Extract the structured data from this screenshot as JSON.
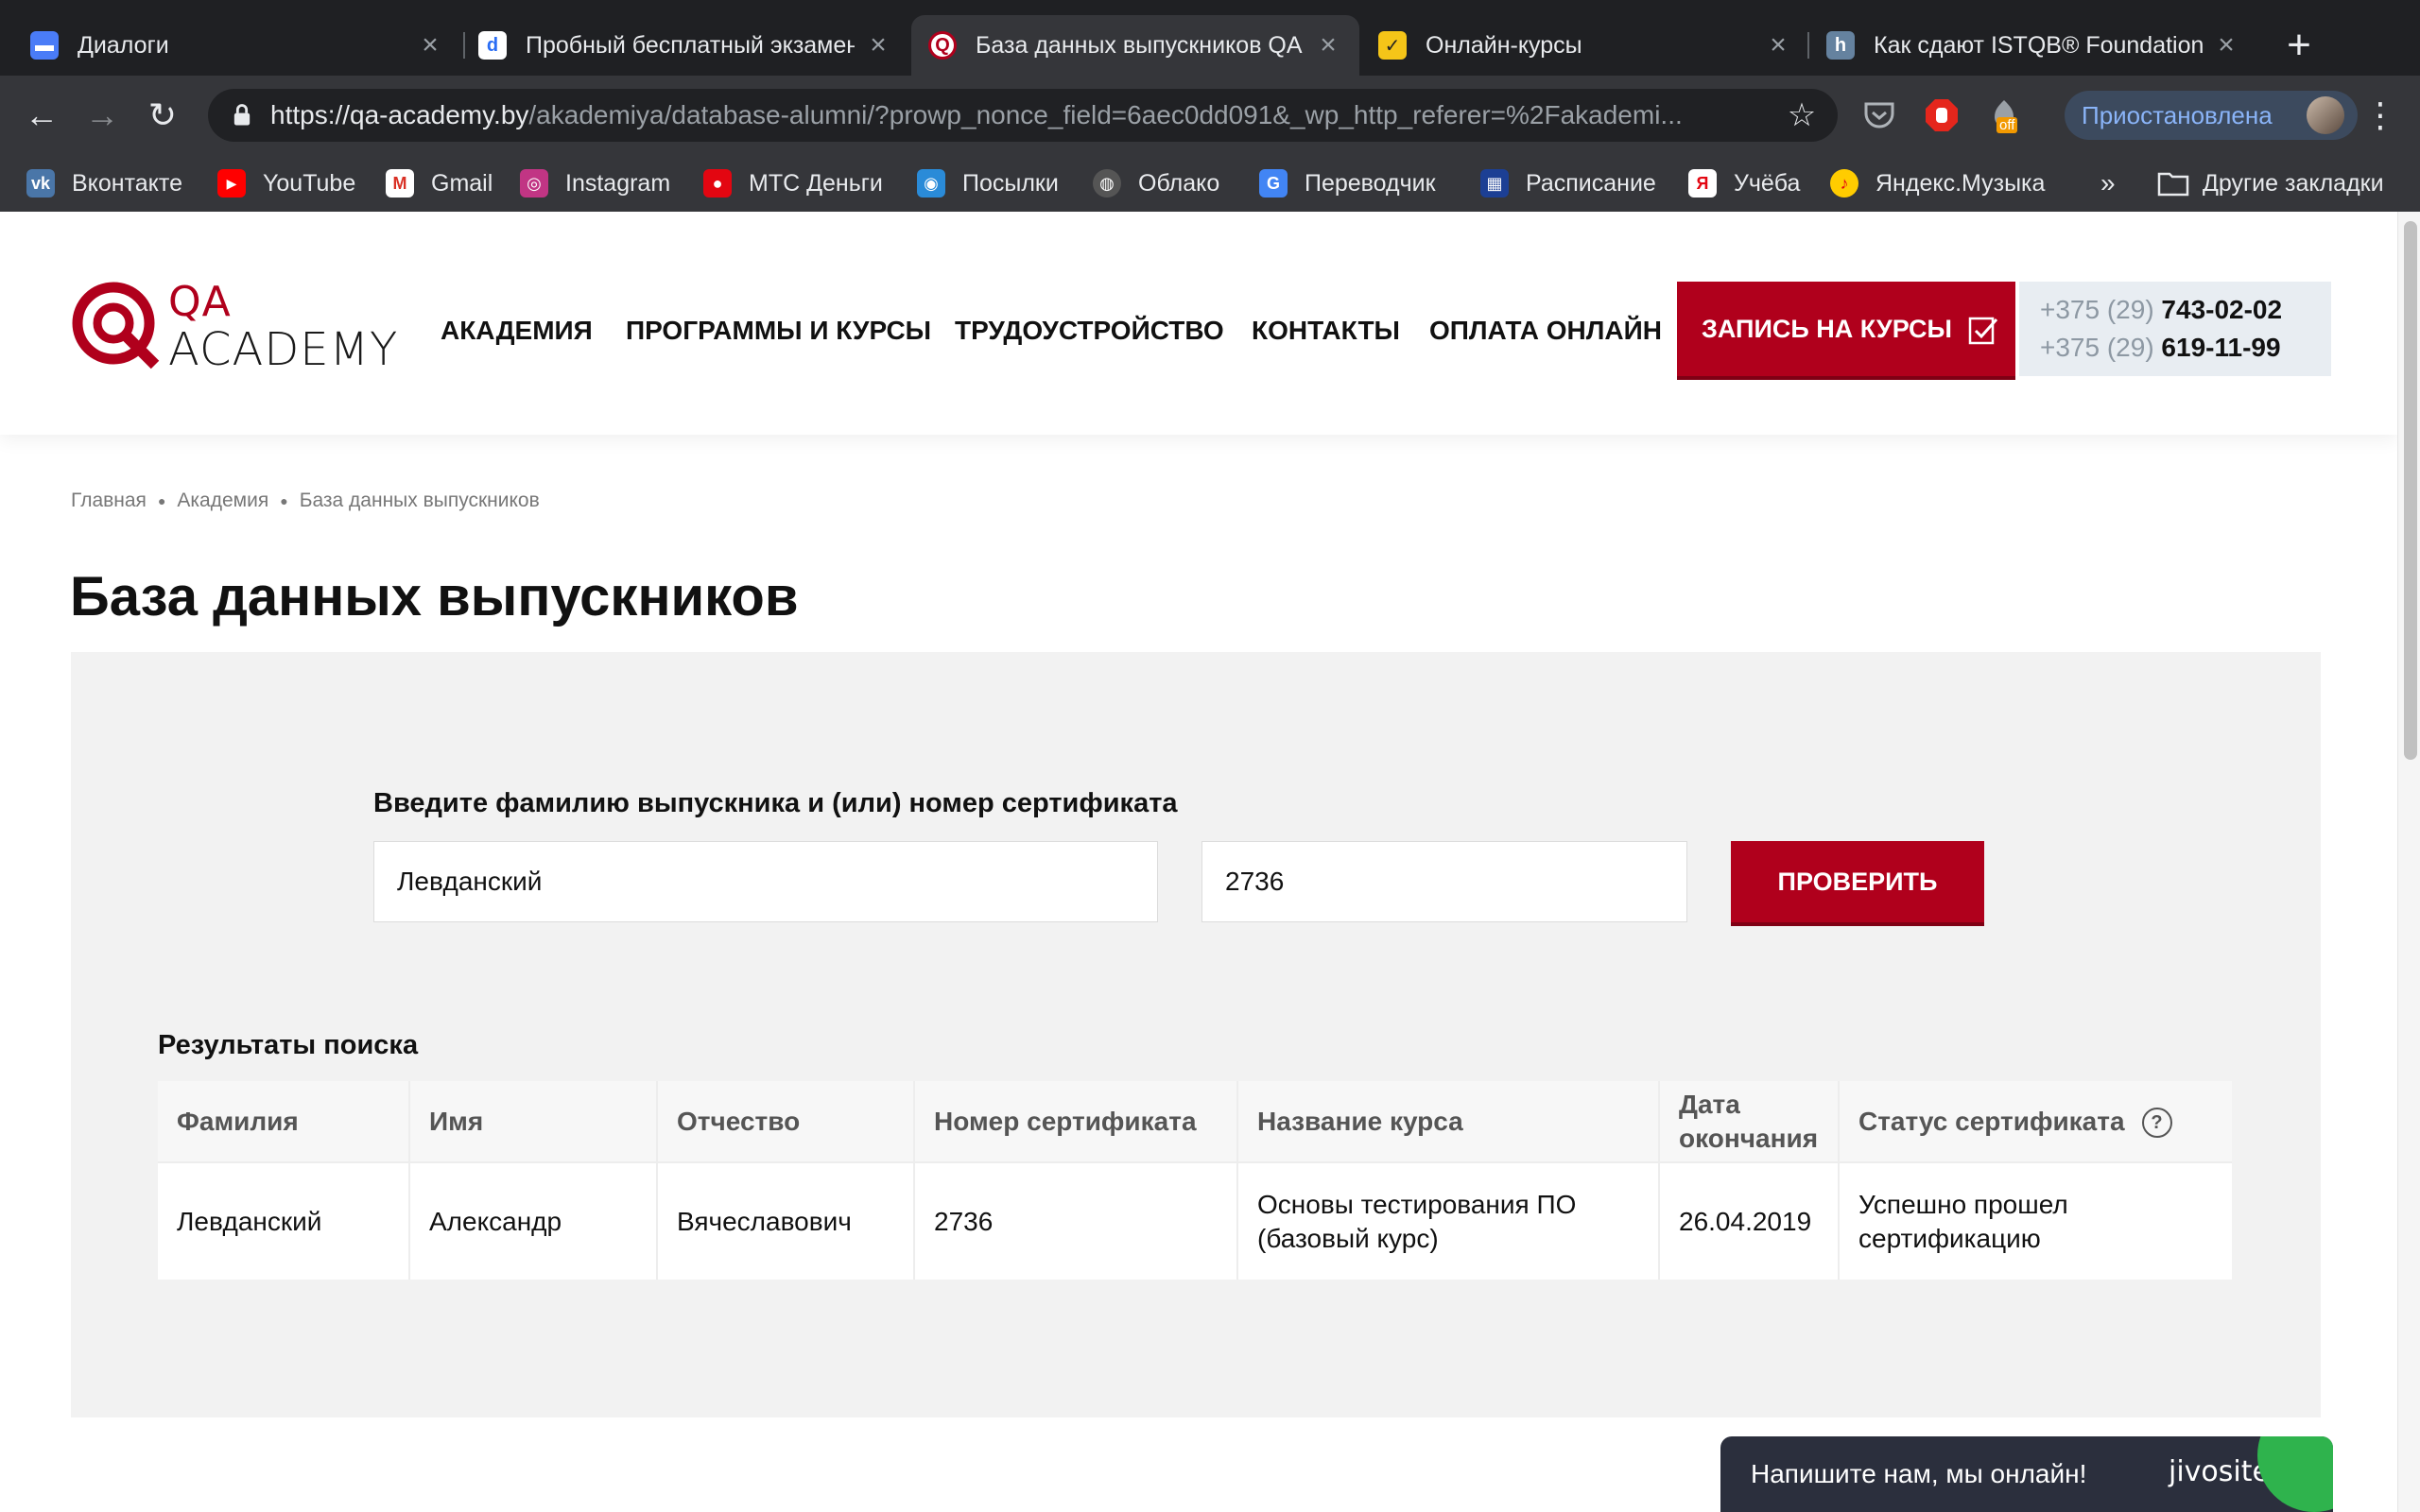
{
  "browser": {
    "tabs": [
      {
        "title": "Диалоги",
        "icon": "chat-bubble-icon",
        "color": "#4a7cf7",
        "active": false
      },
      {
        "title": "Пробный бесплатный экзамен",
        "icon": "d-letter-icon",
        "color": "#2a6df4",
        "active": false
      },
      {
        "title": "База данных выпускников QA",
        "icon": "qa-logo-icon",
        "color": "#b0001c",
        "active": true
      },
      {
        "title": "Онлайн-курсы",
        "icon": "checkbox-yellow-icon",
        "color": "#f5c518",
        "active": false
      },
      {
        "title": "Как сдают ISTQB® Foundation",
        "icon": "h-letter-icon",
        "color": "#65829f",
        "active": false
      }
    ],
    "url_main": "https://qa-academy.by",
    "url_rest": "/akademiya/database-alumni/?prowp_nonce_field=6aec0dd091&_wp_http_referer=%2Fakademi...",
    "profile_status": "Приостановлена",
    "ext_badge": "off",
    "bookmarks": [
      {
        "label": "Вконтакте",
        "icon": "vk-icon",
        "color": "#4a76a8"
      },
      {
        "label": "YouTube",
        "icon": "youtube-icon",
        "color": "#ff0000"
      },
      {
        "label": "Gmail",
        "icon": "gmail-icon",
        "color": "#d93025"
      },
      {
        "label": "Instagram",
        "icon": "instagram-icon",
        "color": "#c13584"
      },
      {
        "label": "МТС Деньги",
        "icon": "mts-icon",
        "color": "#e30611"
      },
      {
        "label": "Посылки",
        "icon": "parcel-icon",
        "color": "#2a8bd8"
      },
      {
        "label": "Облако",
        "icon": "globe-icon",
        "color": "#555555"
      },
      {
        "label": "Переводчик",
        "icon": "translate-icon",
        "color": "#4285f4"
      },
      {
        "label": "Расписание",
        "icon": "schedule-icon",
        "color": "#1c3f94"
      },
      {
        "label": "Учёба",
        "icon": "yandex-icon",
        "color": "#ffffff"
      },
      {
        "label": "Яндекс.Музыка",
        "icon": "music-icon",
        "color": "#ffcc00"
      }
    ],
    "more_bookmarks": "»",
    "other_bookmarks": "Другие закладки"
  },
  "site": {
    "logo_qa": "QA",
    "logo_academy": "ACADEMY",
    "nav": [
      "АКАДЕМИЯ",
      "ПРОГРАММЫ И КУРСЫ",
      "ТРУДОУСТРОЙСТВО",
      "КОНТАКТЫ",
      "ОПЛАТА ОНЛАЙН"
    ],
    "cta": "ЗАПИСЬ НА КУРСЫ",
    "phones": [
      {
        "code": "+375 (29)",
        "number": "743-02-02"
      },
      {
        "code": "+375 (29)",
        "number": "619-11-99"
      }
    ],
    "accent": "#b0001c"
  },
  "breadcrumb": [
    "Главная",
    "Академия",
    "База данных выпускников"
  ],
  "page_title": "База данных выпускников",
  "search": {
    "label": "Введите фамилию выпускника и (или) номер сертификата",
    "surname_value": "Левданский",
    "cert_value": "2736",
    "button": "ПРОВЕРИТЬ"
  },
  "results": {
    "title": "Результаты поиска",
    "columns": [
      "Фамилия",
      "Имя",
      "Отчество",
      "Номер сертификата",
      "Название курса",
      "Дата окончания",
      "Статус сертификата"
    ],
    "help": "?",
    "rows": [
      [
        "Левданский",
        "Александр",
        "Вячеславович",
        "2736",
        "Основы тестирования ПО (базовый курс)",
        "26.04.2019",
        "Успешно прошел сертификацию"
      ]
    ]
  },
  "chat": {
    "text": "Напишите нам, мы онлайн!",
    "brand": "jivosite"
  }
}
